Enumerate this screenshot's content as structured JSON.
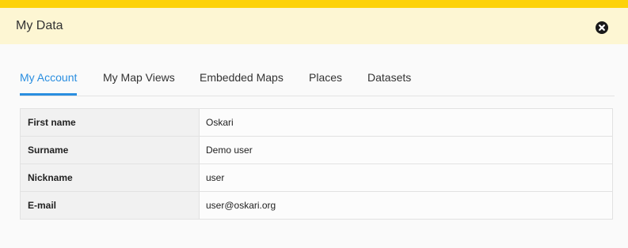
{
  "header": {
    "title": "My Data",
    "close_icon": "close-icon"
  },
  "colors": {
    "stripe": "#fdd20a",
    "header_bg": "#fdf6d3",
    "accent": "#2a8ee0"
  },
  "tabs": [
    {
      "label": "My Account",
      "active": true
    },
    {
      "label": "My Map Views",
      "active": false
    },
    {
      "label": "Embedded Maps",
      "active": false
    },
    {
      "label": "Places",
      "active": false
    },
    {
      "label": "Datasets",
      "active": false
    }
  ],
  "account": {
    "rows": [
      {
        "label": "First name",
        "value": "Oskari"
      },
      {
        "label": "Surname",
        "value": "Demo user"
      },
      {
        "label": "Nickname",
        "value": "user"
      },
      {
        "label": "E-mail",
        "value": "user@oskari.org"
      }
    ]
  }
}
